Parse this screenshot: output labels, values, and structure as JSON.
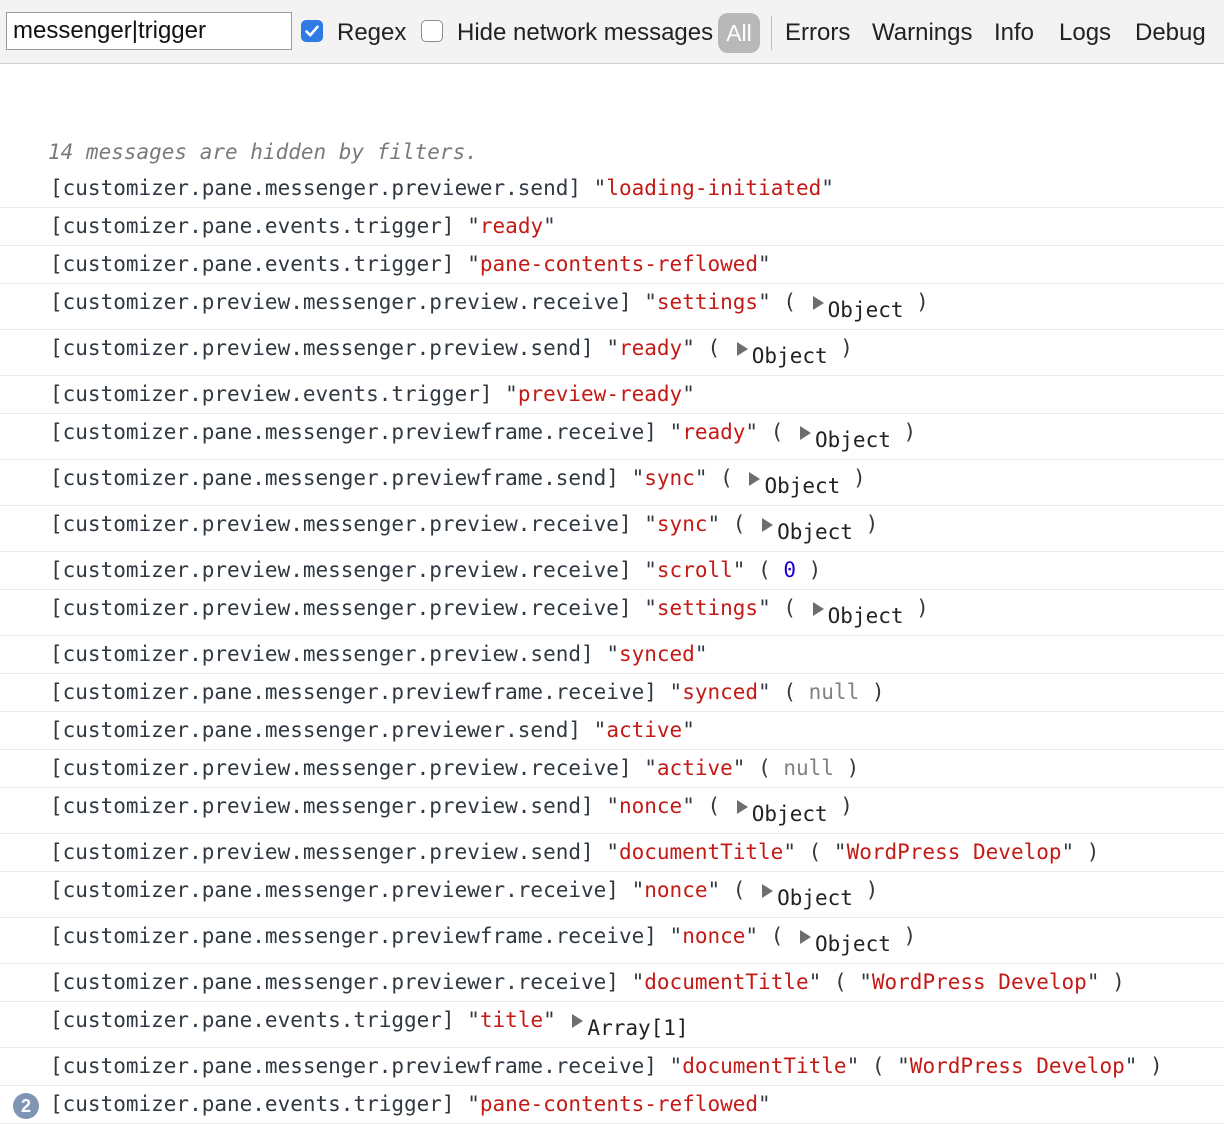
{
  "toolbar": {
    "filter_value": "messenger|trigger",
    "regex_label": "Regex",
    "regex_checked": true,
    "hide_network_label": "Hide network messages",
    "hide_network_checked": false,
    "levels": [
      "All",
      "Errors",
      "Warnings",
      "Info",
      "Logs",
      "Debug"
    ]
  },
  "console": {
    "hidden_note": "14 messages are hidden by filters.",
    "last_repeat_count": "2",
    "colors": {
      "string": "#c41a16",
      "number": "#1c00cf",
      "null": "#808080",
      "badge": "#7f95b3"
    },
    "messages": [
      {
        "prefix": "[customizer.pane.messenger.previewer.send]",
        "event": "loading-initiated",
        "arg_type": "none",
        "arg": ""
      },
      {
        "prefix": "[customizer.pane.events.trigger]",
        "event": "ready",
        "arg_type": "none",
        "arg": ""
      },
      {
        "prefix": "[customizer.pane.events.trigger]",
        "event": "pane-contents-reflowed",
        "arg_type": "none",
        "arg": ""
      },
      {
        "prefix": "[customizer.preview.messenger.preview.receive]",
        "event": "settings",
        "arg_type": "object",
        "arg": "Object"
      },
      {
        "prefix": "[customizer.preview.messenger.preview.send]",
        "event": "ready",
        "arg_type": "object",
        "arg": "Object"
      },
      {
        "prefix": "[customizer.preview.events.trigger]",
        "event": "preview-ready",
        "arg_type": "none",
        "arg": ""
      },
      {
        "prefix": "[customizer.pane.messenger.previewframe.receive]",
        "event": "ready",
        "arg_type": "object",
        "arg": "Object"
      },
      {
        "prefix": "[customizer.pane.messenger.previewframe.send]",
        "event": "sync",
        "arg_type": "object",
        "arg": "Object"
      },
      {
        "prefix": "[customizer.preview.messenger.preview.receive]",
        "event": "sync",
        "arg_type": "object",
        "arg": "Object"
      },
      {
        "prefix": "[customizer.preview.messenger.preview.receive]",
        "event": "scroll",
        "arg_type": "number",
        "arg": "0"
      },
      {
        "prefix": "[customizer.preview.messenger.preview.receive]",
        "event": "settings",
        "arg_type": "object",
        "arg": "Object"
      },
      {
        "prefix": "[customizer.preview.messenger.preview.send]",
        "event": "synced",
        "arg_type": "none",
        "arg": ""
      },
      {
        "prefix": "[customizer.pane.messenger.previewframe.receive]",
        "event": "synced",
        "arg_type": "null",
        "arg": "null"
      },
      {
        "prefix": "[customizer.pane.messenger.previewer.send]",
        "event": "active",
        "arg_type": "none",
        "arg": ""
      },
      {
        "prefix": "[customizer.preview.messenger.preview.receive]",
        "event": "active",
        "arg_type": "null",
        "arg": "null"
      },
      {
        "prefix": "[customizer.preview.messenger.preview.send]",
        "event": "nonce",
        "arg_type": "object",
        "arg": "Object"
      },
      {
        "prefix": "[customizer.preview.messenger.preview.send]",
        "event": "documentTitle",
        "arg_type": "string",
        "arg": "WordPress Develop"
      },
      {
        "prefix": "[customizer.pane.messenger.previewer.receive]",
        "event": "nonce",
        "arg_type": "object",
        "arg": "Object"
      },
      {
        "prefix": "[customizer.pane.messenger.previewframe.receive]",
        "event": "nonce",
        "arg_type": "object",
        "arg": "Object"
      },
      {
        "prefix": "[customizer.pane.messenger.previewer.receive]",
        "event": "documentTitle",
        "arg_type": "string",
        "arg": "WordPress Develop"
      },
      {
        "prefix": "[customizer.pane.events.trigger]",
        "event": "title",
        "arg_type": "array",
        "arg": "Array[1]"
      },
      {
        "prefix": "[customizer.pane.messenger.previewframe.receive]",
        "event": "documentTitle",
        "arg_type": "string",
        "arg": "WordPress Develop"
      },
      {
        "prefix": "[customizer.pane.events.trigger]",
        "event": "pane-contents-reflowed",
        "arg_type": "none",
        "arg": ""
      }
    ]
  }
}
